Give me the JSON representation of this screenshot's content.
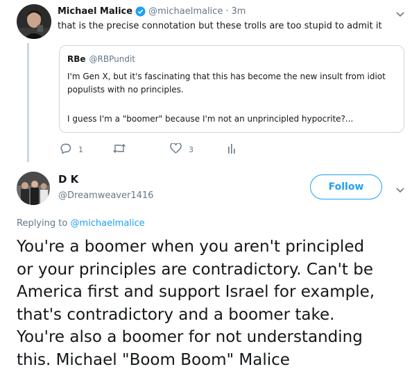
{
  "tweet": {
    "author_name": "Michael Malice",
    "handle": "@michaelmalice",
    "separator": "·",
    "time": "3m",
    "text": "that is the precise connotation but these trolls are too stupid to admit it",
    "verified": true,
    "quoted": {
      "author_name": "RBe",
      "handle": "@RBPundit",
      "line1": "I'm Gen X, but it's fascinating that this has become the new insult from idiot",
      "line2": "populists with no principles.",
      "line3": "I guess I'm a \"boomer\" because I'm not an unprincipled hypocrite?..."
    },
    "actions": {
      "reply_count": "1",
      "retweet_count": "",
      "like_count": "3"
    }
  },
  "reply": {
    "author_name": "D K",
    "handle": "@Dreamweaver1416",
    "follow_label": "Follow",
    "replying_prefix": "Replying to",
    "replying_handle": "@michaelmalice",
    "text_lines": [
      "You're a boomer when you aren't principled",
      "or your principles are contradictory. Can't be",
      "America first and support Israel for example,",
      "that's contradictory and a boomer take.",
      "You're also a boomer for not understanding",
      "this. Michael \"Boom Boom\" Malice"
    ]
  },
  "colors": {
    "accent": "#1da1f2",
    "secondary_text": "#657786",
    "border": "#ccd6dd"
  },
  "icons": [
    "chevron-down-icon",
    "verified-badge-icon",
    "reply-icon",
    "retweet-icon",
    "like-icon",
    "analytics-icon"
  ]
}
